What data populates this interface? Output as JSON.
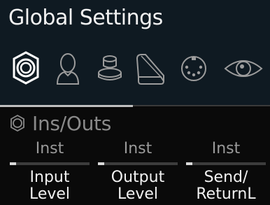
{
  "header": {
    "title": "Global Settings"
  },
  "categories": [
    {
      "icon": "ins-outs-icon",
      "selected": true
    },
    {
      "icon": "user-icon",
      "selected": false
    },
    {
      "icon": "footswitch-icon",
      "selected": false
    },
    {
      "icon": "expression-pedal-icon",
      "selected": false
    },
    {
      "icon": "midi-icon",
      "selected": false
    },
    {
      "icon": "eye-icon",
      "selected": false
    }
  ],
  "section": {
    "title": "Ins/Outs"
  },
  "params": [
    {
      "value": "Inst",
      "name_line1": "Input",
      "name_line2": "Level",
      "level": 0.08
    },
    {
      "value": "Inst",
      "name_line1": "Output",
      "name_line2": "Level",
      "level": 0.08
    },
    {
      "value": "Inst",
      "name_line1": "Send/",
      "name_line2": "ReturnL",
      "level": 0.08
    }
  ],
  "colors": {
    "background": "#0a0a0a",
    "top_panel": "#0f1a22",
    "text_primary": "#f2f2f2",
    "text_secondary": "#9a9a9a",
    "accent": "#d9d9d9"
  }
}
